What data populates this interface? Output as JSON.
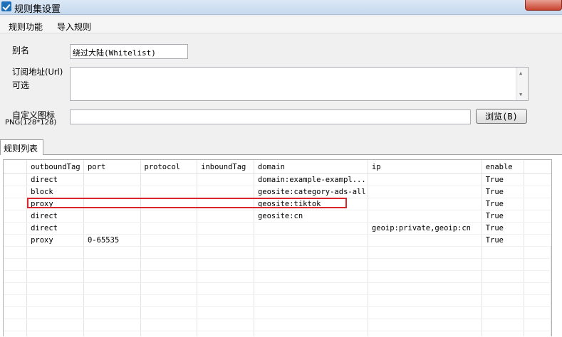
{
  "window": {
    "title": "规则集设置"
  },
  "menu": [
    "规则功能",
    "导入规则"
  ],
  "form": {
    "alias_label": "别名",
    "alias_value": "绕过大陆(Whitelist)",
    "url_label_1": "订阅地址(Url)",
    "url_label_2": "可选",
    "url_value": "",
    "icon_label_1": "自定义图标",
    "icon_label_2": "PNG(128*128)",
    "icon_value": "",
    "browse_label": "浏览(B)"
  },
  "tabs": [
    "规则列表"
  ],
  "table": {
    "columns": [
      "outboundTag",
      "port",
      "protocol",
      "inboundTag",
      "domain",
      "ip",
      "enable"
    ],
    "rows": [
      [
        "direct",
        "",
        "",
        "",
        "domain:example-exampl...",
        "",
        "True"
      ],
      [
        "block",
        "",
        "",
        "",
        "geosite:category-ads-all",
        "",
        "True"
      ],
      [
        "proxy",
        "",
        "",
        "",
        "geosite:tiktok",
        "",
        "True"
      ],
      [
        "direct",
        "",
        "",
        "",
        "geosite:cn",
        "",
        "True"
      ],
      [
        "direct",
        "",
        "",
        "",
        "",
        "geoip:private,geoip:cn",
        "True"
      ],
      [
        "proxy",
        "0-65535",
        "",
        "",
        "",
        "",
        "True"
      ]
    ],
    "empty_rows": 8,
    "highlight_color": "#d9262c"
  }
}
